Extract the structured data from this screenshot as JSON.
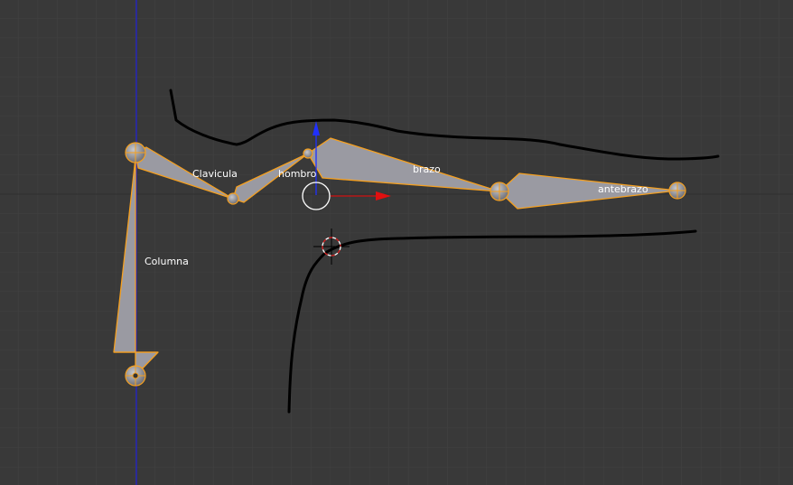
{
  "viewport": {
    "background": "#393939",
    "grid_color": "#424242",
    "selection_color": "#f5a020",
    "bone_fill": "#9a9aa2"
  },
  "bones": [
    {
      "name": "Columna"
    },
    {
      "name": "Clavicula"
    },
    {
      "name": "hombro"
    },
    {
      "name": "brazo"
    },
    {
      "name": "antebrazo"
    }
  ],
  "icons": {
    "manipulator": "transform-gizmo-icon",
    "cursor": "3d-cursor-icon"
  }
}
